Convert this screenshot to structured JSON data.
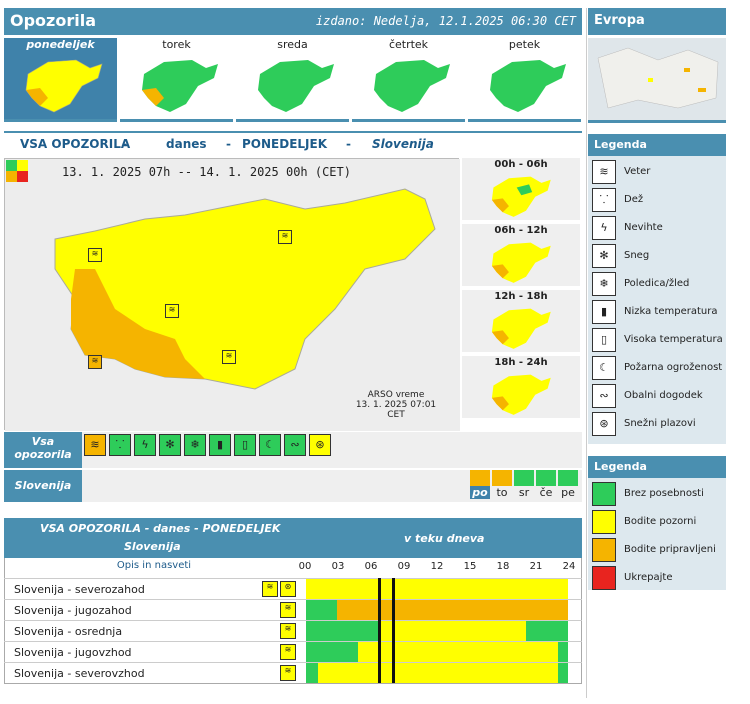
{
  "header": {
    "title": "Opozorila",
    "issued": "izdano: Nedelja, 12.1.2025 06:30 CET",
    "europe": "Evropa"
  },
  "days": [
    "ponedeljek",
    "torek",
    "sreda",
    "četrtek",
    "petek"
  ],
  "section": {
    "all": "VSA OPOZORILA",
    "sep": "-",
    "today": "danes",
    "day": "PONEDELJEK",
    "region": "Slovenija"
  },
  "period": "13. 1. 2025 07h -- 14. 1. 2025 00h  (CET)",
  "arso": {
    "line1": "ARSO vreme",
    "line2": "13. 1. 2025 07:01 CET"
  },
  "slots": [
    "00h - 06h",
    "06h - 12h",
    "12h - 18h",
    "18h - 24h"
  ],
  "warn_label": "Vsa opozorila",
  "slovenia_label": "Slovenija",
  "weekdays_short": [
    "po",
    "to",
    "sr",
    "če",
    "pe"
  ],
  "colors": {
    "green": "#2ecc5a",
    "yellow": "#ffff00",
    "orange": "#f5b400",
    "red": "#e8241f",
    "blue": "#4a8fb0"
  },
  "table": {
    "title": "VSA OPOZORILA - danes - PONEDELJEK",
    "subtitle": "Slovenija",
    "during": "v teku dneva",
    "opis": "Opis in nasveti",
    "hours": [
      "00",
      "03",
      "06",
      "09",
      "12",
      "15",
      "18",
      "21",
      "24"
    ],
    "rows": [
      {
        "name": "Slovenija - severozahod"
      },
      {
        "name": "Slovenija - jugozahod"
      },
      {
        "name": "Slovenija - osrednja"
      },
      {
        "name": "Slovenija - jugovzhod"
      },
      {
        "name": "Slovenija - severovzhod"
      }
    ]
  },
  "legend1": {
    "title": "Legenda",
    "items": [
      "Veter",
      "Dež",
      "Nevihte",
      "Sneg",
      "Poledica/žled",
      "Nizka temperatura",
      "Visoka temperatura",
      "Požarna ogroženost",
      "Obalni dogodek",
      "Snežni plazovi"
    ]
  },
  "legend2": {
    "title": "Legenda",
    "items": [
      "Brez posebnosti",
      "Bodite pozorni",
      "Bodite pripravljeni",
      "Ukrepajte"
    ]
  }
}
